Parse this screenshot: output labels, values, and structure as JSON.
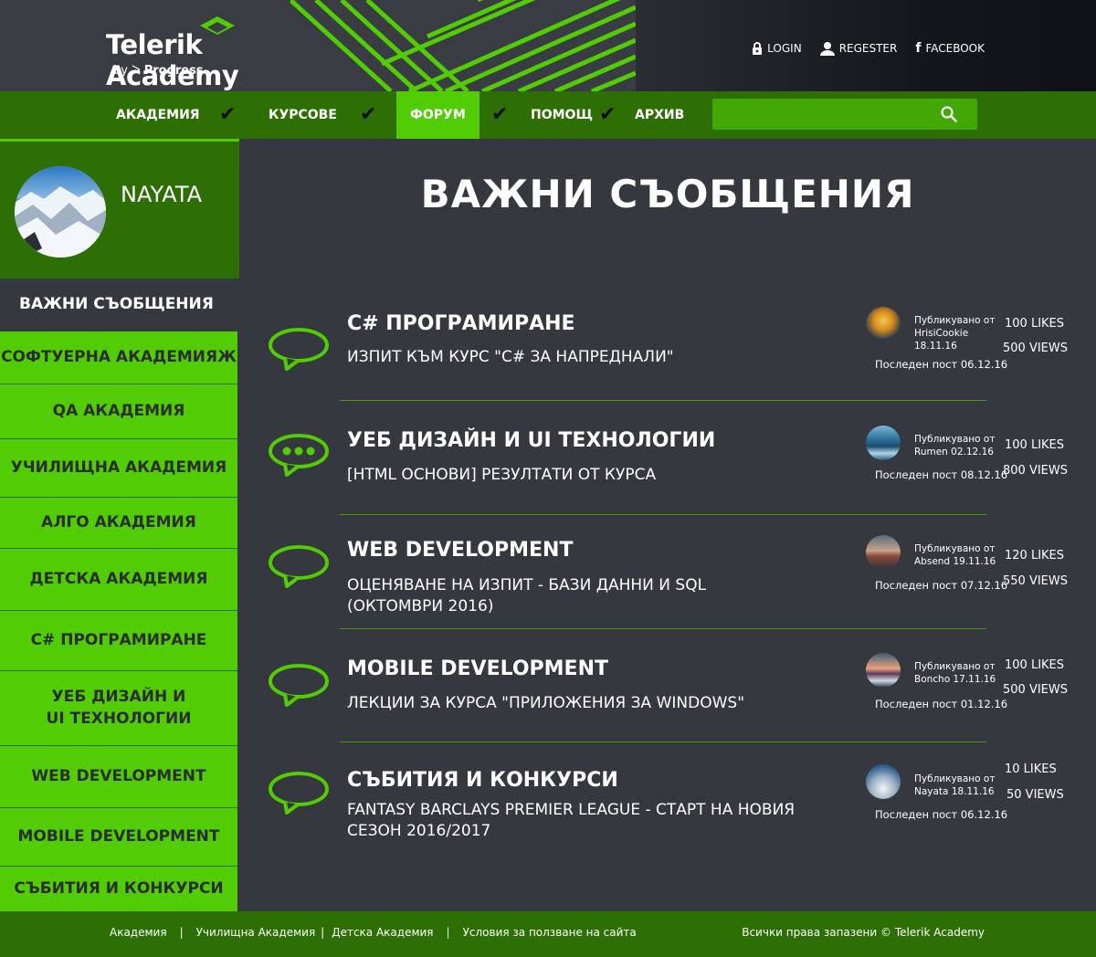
{
  "brand": {
    "name": "Telerik Academy",
    "by": "by",
    "progress": "Progress"
  },
  "top_links": {
    "login": "LOGIN",
    "register": "REGESTER",
    "facebook": "FACEBOOK"
  },
  "nav": {
    "items": [
      "АКАДЕМИЯ",
      "КУРСОВЕ",
      "ФОРУМ",
      "ПОМОЩ",
      "АРХИВ"
    ],
    "active": "ФОРУМ",
    "search_placeholder": ""
  },
  "user": {
    "name": "NAYATA"
  },
  "sidebar": {
    "items": [
      "ВАЖНИ СЪОБЩЕНИЯ",
      "СОФТУЕРНА АКАДЕМИЯЖ",
      "QA АКАДЕМИЯ",
      "УЧИЛИЩНА АКАДЕМИЯ",
      "АЛГО АКАДЕМИЯ",
      "ДЕТСКА АКАДЕМИЯ",
      "C# ПРОГРАМИРАНЕ",
      "УЕБ ДИЗАЙН И UI ТЕХНОЛОГИИ",
      "WEB DEVELOPMENT",
      "MOBILE DEVELOPMENT",
      "СЪБИТИЯ И КОНКУРСИ"
    ],
    "selected": "ВАЖНИ СЪОБЩЕНИЯ"
  },
  "page": {
    "title": "ВАЖНИ СЪОБЩЕНИЯ"
  },
  "topics": [
    {
      "title": "C# ПРОГРАМИРАНЕ",
      "subtitle": "ИЗПИТ КЪМ КУРС \"C# ЗА НАПРЕДНАЛИ\"",
      "published_label": "Публикувано от",
      "author": "HrisiCookie",
      "date": "18.11.16",
      "last_post": "Последен пост 06.12.16",
      "likes": "100 LIKES",
      "views": "500 VIEWS",
      "bubble": "empty"
    },
    {
      "title": "УЕБ ДИЗАЙН И UI ТЕХНОЛОГИИ",
      "subtitle": "[HTML ОСНОВИ] РЕЗУЛТАТИ ОТ КУРСА",
      "published_label": "Публикувано от",
      "author": "Rumen",
      "date": "02.12.16",
      "last_post": "Последен пост 08.12.16",
      "likes": "100 LIKES",
      "views": "800 VIEWS",
      "bubble": "dots"
    },
    {
      "title": "WEB DEVELOPMENT",
      "subtitle": "ОЦЕНЯВАНЕ НА ИЗПИТ - БАЗИ ДАННИ И SQL (ОКТОМВРИ 2016)",
      "published_label": "Публикувано от",
      "author": "Absend",
      "date": "19.11.16",
      "last_post": "Последен пост 07.12.16",
      "likes": "120 LIKES",
      "views": "550 VIEWS",
      "bubble": "empty"
    },
    {
      "title": "MOBILE DEVELOPMENT",
      "subtitle": "ЛЕКЦИИ ЗА КУРСА \"ПРИЛОЖЕНИЯ ЗА WINDOWS\"",
      "published_label": "Публикувано от",
      "author": "Boncho",
      "date": "17.11.16",
      "last_post": "Последен пост 01.12.16",
      "likes": "100 LIKES",
      "views": "500 VIEWS",
      "bubble": "empty"
    },
    {
      "title": "СЪБИТИЯ И КОНКУРСИ",
      "subtitle": "FANTASY BARCLAYS PREMIER LEAGUE - СТАРТ НА НОВИЯ СЕЗОН 2016/2017",
      "published_label": "Публикувано от",
      "author": "Nayata",
      "date": "18.11.16",
      "last_post": "Последен пост 06.12.16",
      "likes": "10 LIKES",
      "views": "50 VIEWS",
      "bubble": "empty"
    }
  ],
  "footer": {
    "links": [
      "Академия",
      "Училищна Академия",
      "Детска Академия",
      "Условия за ползване на сайта"
    ],
    "copyright": "Всички права запазени  ©  Telerik Academy"
  },
  "colors": {
    "accent": "#52cc05",
    "dark_green": "#2d6e05",
    "background": "#35383f"
  }
}
